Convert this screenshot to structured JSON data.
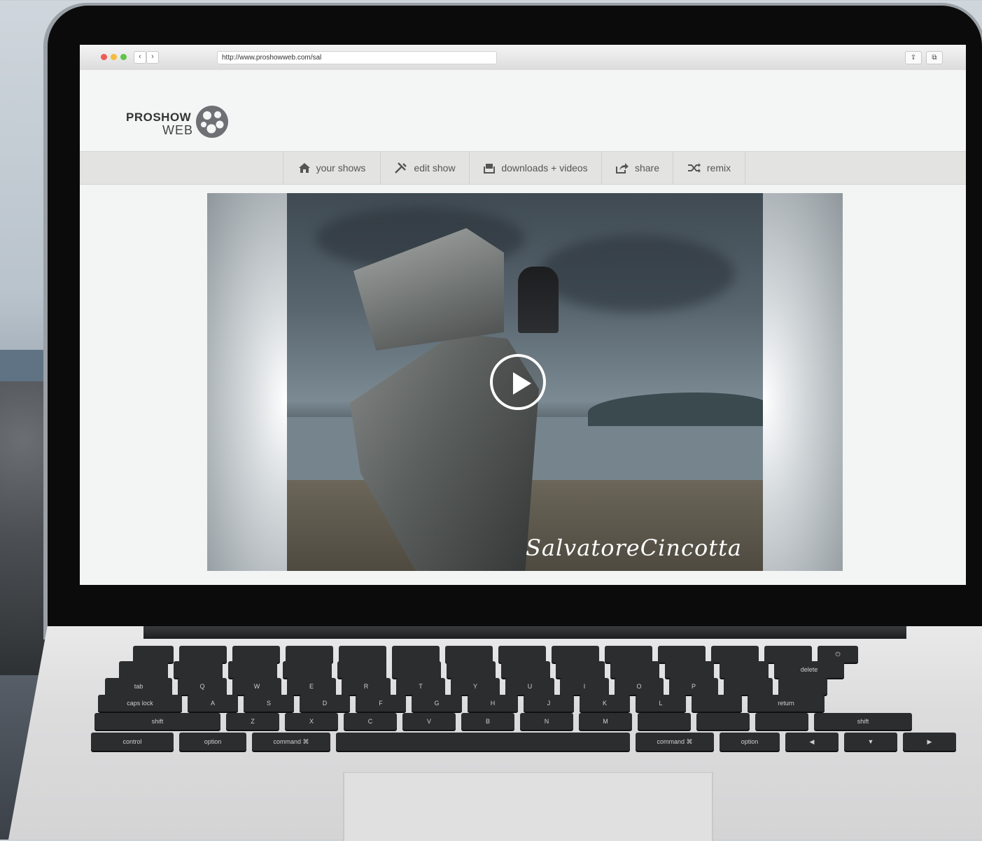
{
  "browser": {
    "url": "http://www.proshowweb.com/sal",
    "back_label": "‹",
    "forward_label": "›",
    "share_label": "⇪",
    "tabs_label": "⧉"
  },
  "site": {
    "logo_line1": "PROSHOW",
    "logo_line2": "WEB"
  },
  "nav": {
    "items": [
      {
        "label": "your shows",
        "icon": "home-icon"
      },
      {
        "label": "edit show",
        "icon": "tools-icon"
      },
      {
        "label": "downloads + videos",
        "icon": "download-tray-icon"
      },
      {
        "label": "share",
        "icon": "share-icon"
      },
      {
        "label": "remix",
        "icon": "shuffle-icon"
      }
    ]
  },
  "video": {
    "signature": "SalvatoreCincotta",
    "play_icon": "play-icon"
  },
  "keyboard": {
    "row1": [
      "Q",
      "W",
      "E",
      "R",
      "T",
      "Y",
      "U",
      "I",
      "O",
      "P"
    ],
    "row2": [
      "A",
      "S",
      "D",
      "F",
      "G",
      "H",
      "J",
      "K",
      "L"
    ],
    "row3": [
      "Z",
      "X",
      "C",
      "V",
      "B",
      "N",
      "M"
    ],
    "mods": {
      "caps": "caps lock",
      "shift": "shift",
      "control": "control",
      "option": "option",
      "command": "command ⌘",
      "return": "return",
      "delete": "delete",
      "tab": "tab"
    }
  },
  "colors": {
    "nav_bg": "#e3e4e2",
    "page_bg": "#f3f5f5",
    "text_gray": "#555555"
  }
}
